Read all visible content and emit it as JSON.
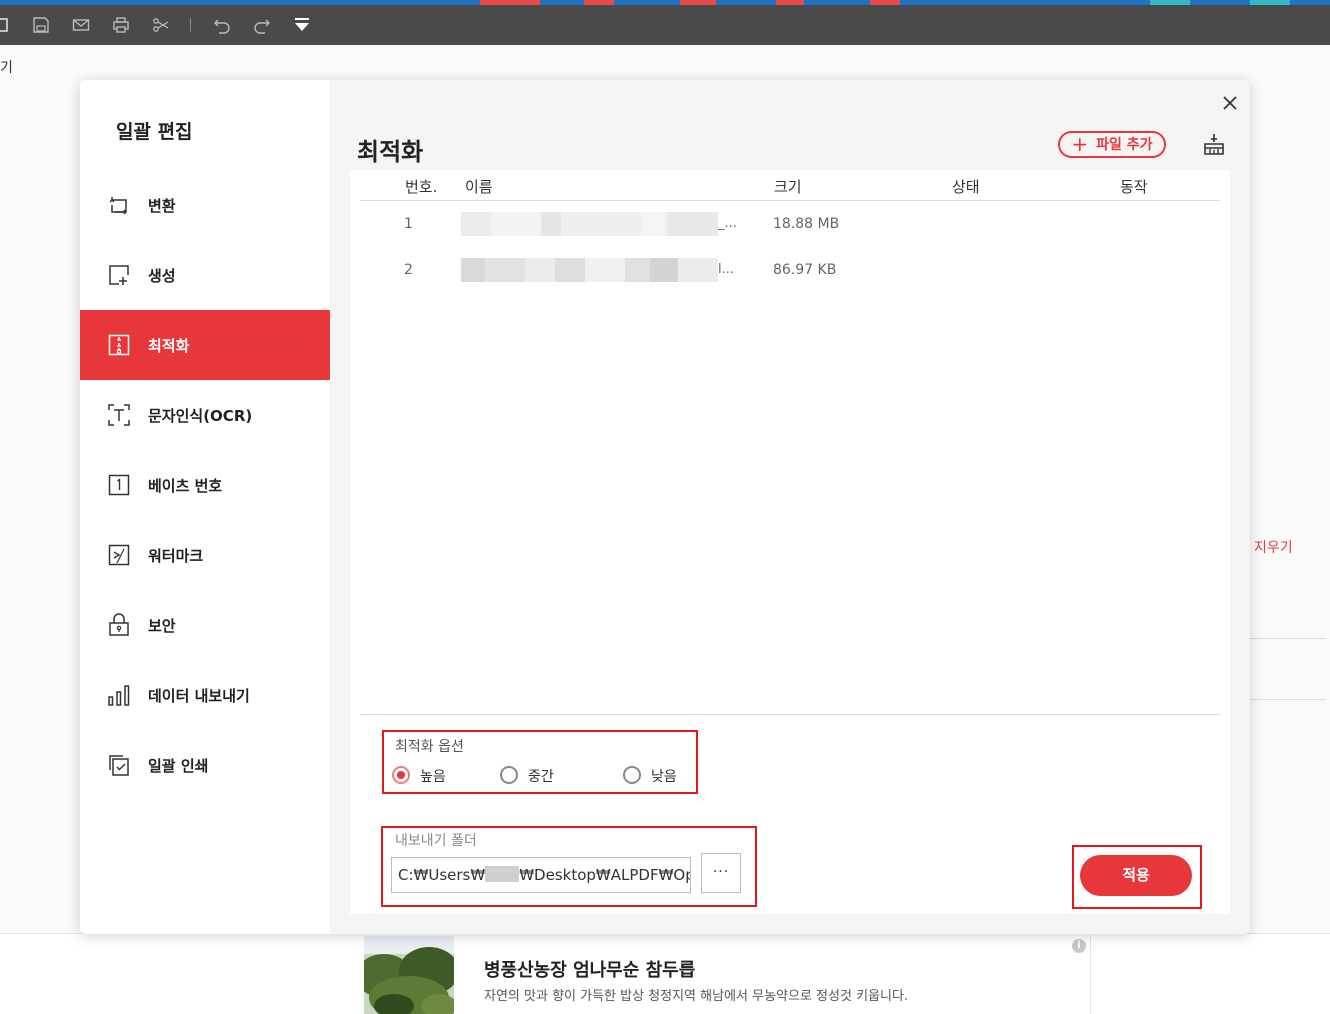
{
  "background_app": {
    "left_partial_label": "기",
    "erase_link": "지우기"
  },
  "ad": {
    "title": "병풍산농장 엄나무순 참두릅",
    "description": "자연의 맛과 향이 가득한 밥상 청정지역 해남에서 무농약으로 정성것 키웁니다.",
    "info_icon": "i"
  },
  "modal": {
    "sidebar_title": "일괄 편집",
    "nav": [
      {
        "label": "변환",
        "icon": "convert-icon"
      },
      {
        "label": "생성",
        "icon": "create-icon"
      },
      {
        "label": "최적화",
        "icon": "optimize-icon",
        "active": true
      },
      {
        "label": "문자인식(OCR)",
        "icon": "ocr-icon"
      },
      {
        "label": "베이츠 번호",
        "icon": "bates-number-icon"
      },
      {
        "label": "워터마크",
        "icon": "watermark-icon"
      },
      {
        "label": "보안",
        "icon": "lock-icon"
      },
      {
        "label": "데이터 내보내기",
        "icon": "bar-chart-icon"
      },
      {
        "label": "일괄 인쇄",
        "icon": "print-icon"
      }
    ],
    "title": "최적화",
    "add_file_label": "파일 추가",
    "table": {
      "headers": {
        "no": "번호.",
        "name": "이름",
        "size": "크기",
        "status": "상태",
        "action": "동작"
      },
      "rows": [
        {
          "no": "1",
          "name_suffix": "_...",
          "size": "18.88 MB"
        },
        {
          "no": "2",
          "name_suffix": "l...",
          "size": "86.97 KB"
        }
      ]
    },
    "options": {
      "title": "최적화 옵션",
      "choices": [
        "높음",
        "중간",
        "낮음"
      ],
      "selected": "높음"
    },
    "export": {
      "title": "내보내기 폴더",
      "path_prefix": "C:₩Users₩",
      "path_suffix": "₩Desktop₩ALPDF₩Optimiz",
      "browse_label": "···"
    },
    "apply_label": "적용"
  },
  "colors": {
    "accent": "#e8373a",
    "highlight_box": "#e3161c",
    "toolbar": "#4a4a4a"
  }
}
